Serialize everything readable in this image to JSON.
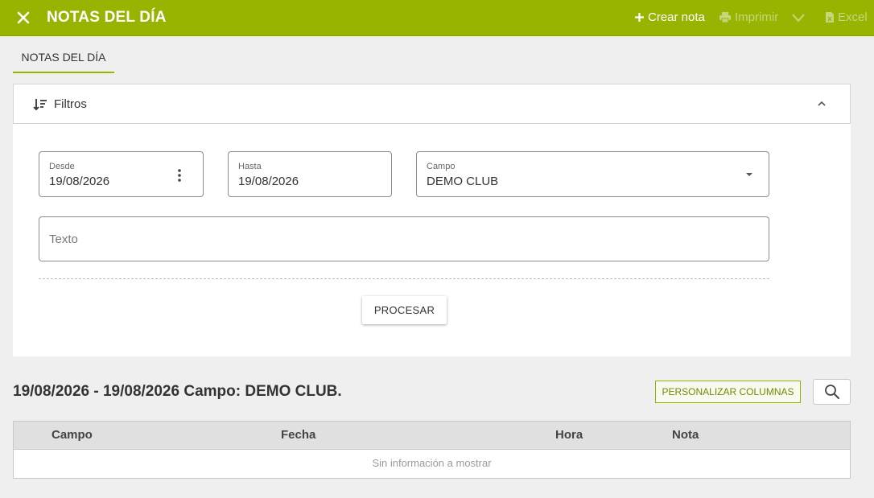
{
  "header": {
    "title": "NOTAS DEL DÍA",
    "actions": {
      "create": "Crear nota",
      "print": "Imprimir",
      "excel": "Excel"
    },
    "color": "#98b400"
  },
  "tabs": [
    {
      "label": "NOTAS DEL DÍA",
      "active": true
    }
  ],
  "filters": {
    "title": "Filtros",
    "desde": {
      "label": "Desde",
      "value": "19/08/2026"
    },
    "hasta": {
      "label": "Hasta",
      "value": "19/08/2026"
    },
    "campo": {
      "label": "Campo",
      "value": "DEMO CLUB"
    },
    "texto": {
      "placeholder": "Texto",
      "value": ""
    },
    "process_label": "PROCESAR"
  },
  "results": {
    "summary": "19/08/2026 - 19/08/2026 Campo: DEMO CLUB.",
    "personalize_label": "PERSONALIZAR COLUMNAS",
    "columns": [
      "Campo",
      "Fecha",
      "Hora",
      "Nota"
    ],
    "rows": [],
    "empty_message": "Sin información a mostrar"
  },
  "icons": {
    "close": "close-icon",
    "create": "plus-icon",
    "print": "printer-icon",
    "chevron": "chevron-down-icon",
    "excel": "excel-file-icon",
    "filter": "sort-filter-icon",
    "collapse": "chevron-up-icon",
    "kebab": "more-vertical-icon",
    "caret": "caret-down-icon",
    "search": "search-icon"
  }
}
